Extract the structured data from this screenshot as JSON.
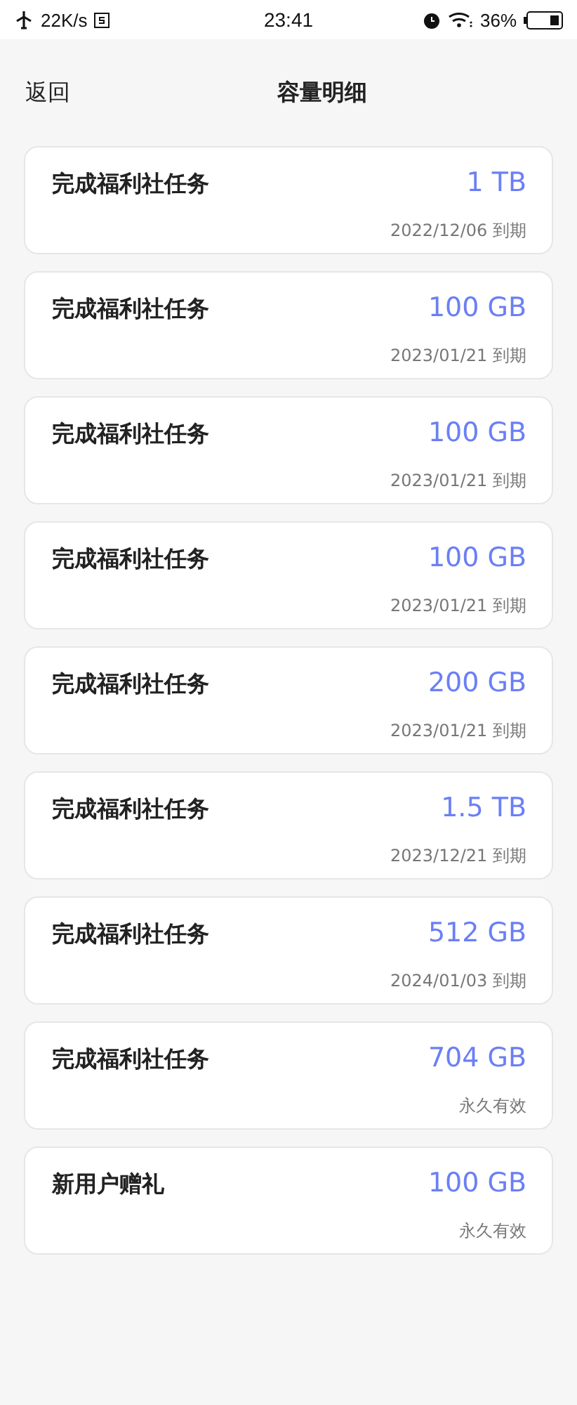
{
  "status_bar": {
    "speed": "22K/s",
    "time": "23:41",
    "battery": "36%"
  },
  "header": {
    "back": "返回",
    "title": "容量明细"
  },
  "items": [
    {
      "title": "完成福利社任务",
      "amount": "1 TB",
      "expiry": "2022/12/06 到期"
    },
    {
      "title": "完成福利社任务",
      "amount": "100 GB",
      "expiry": "2023/01/21 到期"
    },
    {
      "title": "完成福利社任务",
      "amount": "100 GB",
      "expiry": "2023/01/21 到期"
    },
    {
      "title": "完成福利社任务",
      "amount": "100 GB",
      "expiry": "2023/01/21 到期"
    },
    {
      "title": "完成福利社任务",
      "amount": "200 GB",
      "expiry": "2023/01/21 到期"
    },
    {
      "title": "完成福利社任务",
      "amount": "1.5 TB",
      "expiry": "2023/12/21 到期"
    },
    {
      "title": "完成福利社任务",
      "amount": "512 GB",
      "expiry": "2024/01/03 到期"
    },
    {
      "title": "完成福利社任务",
      "amount": "704 GB",
      "expiry": "永久有效"
    },
    {
      "title": "新用户赠礼",
      "amount": "100 GB",
      "expiry": "永久有效"
    }
  ]
}
